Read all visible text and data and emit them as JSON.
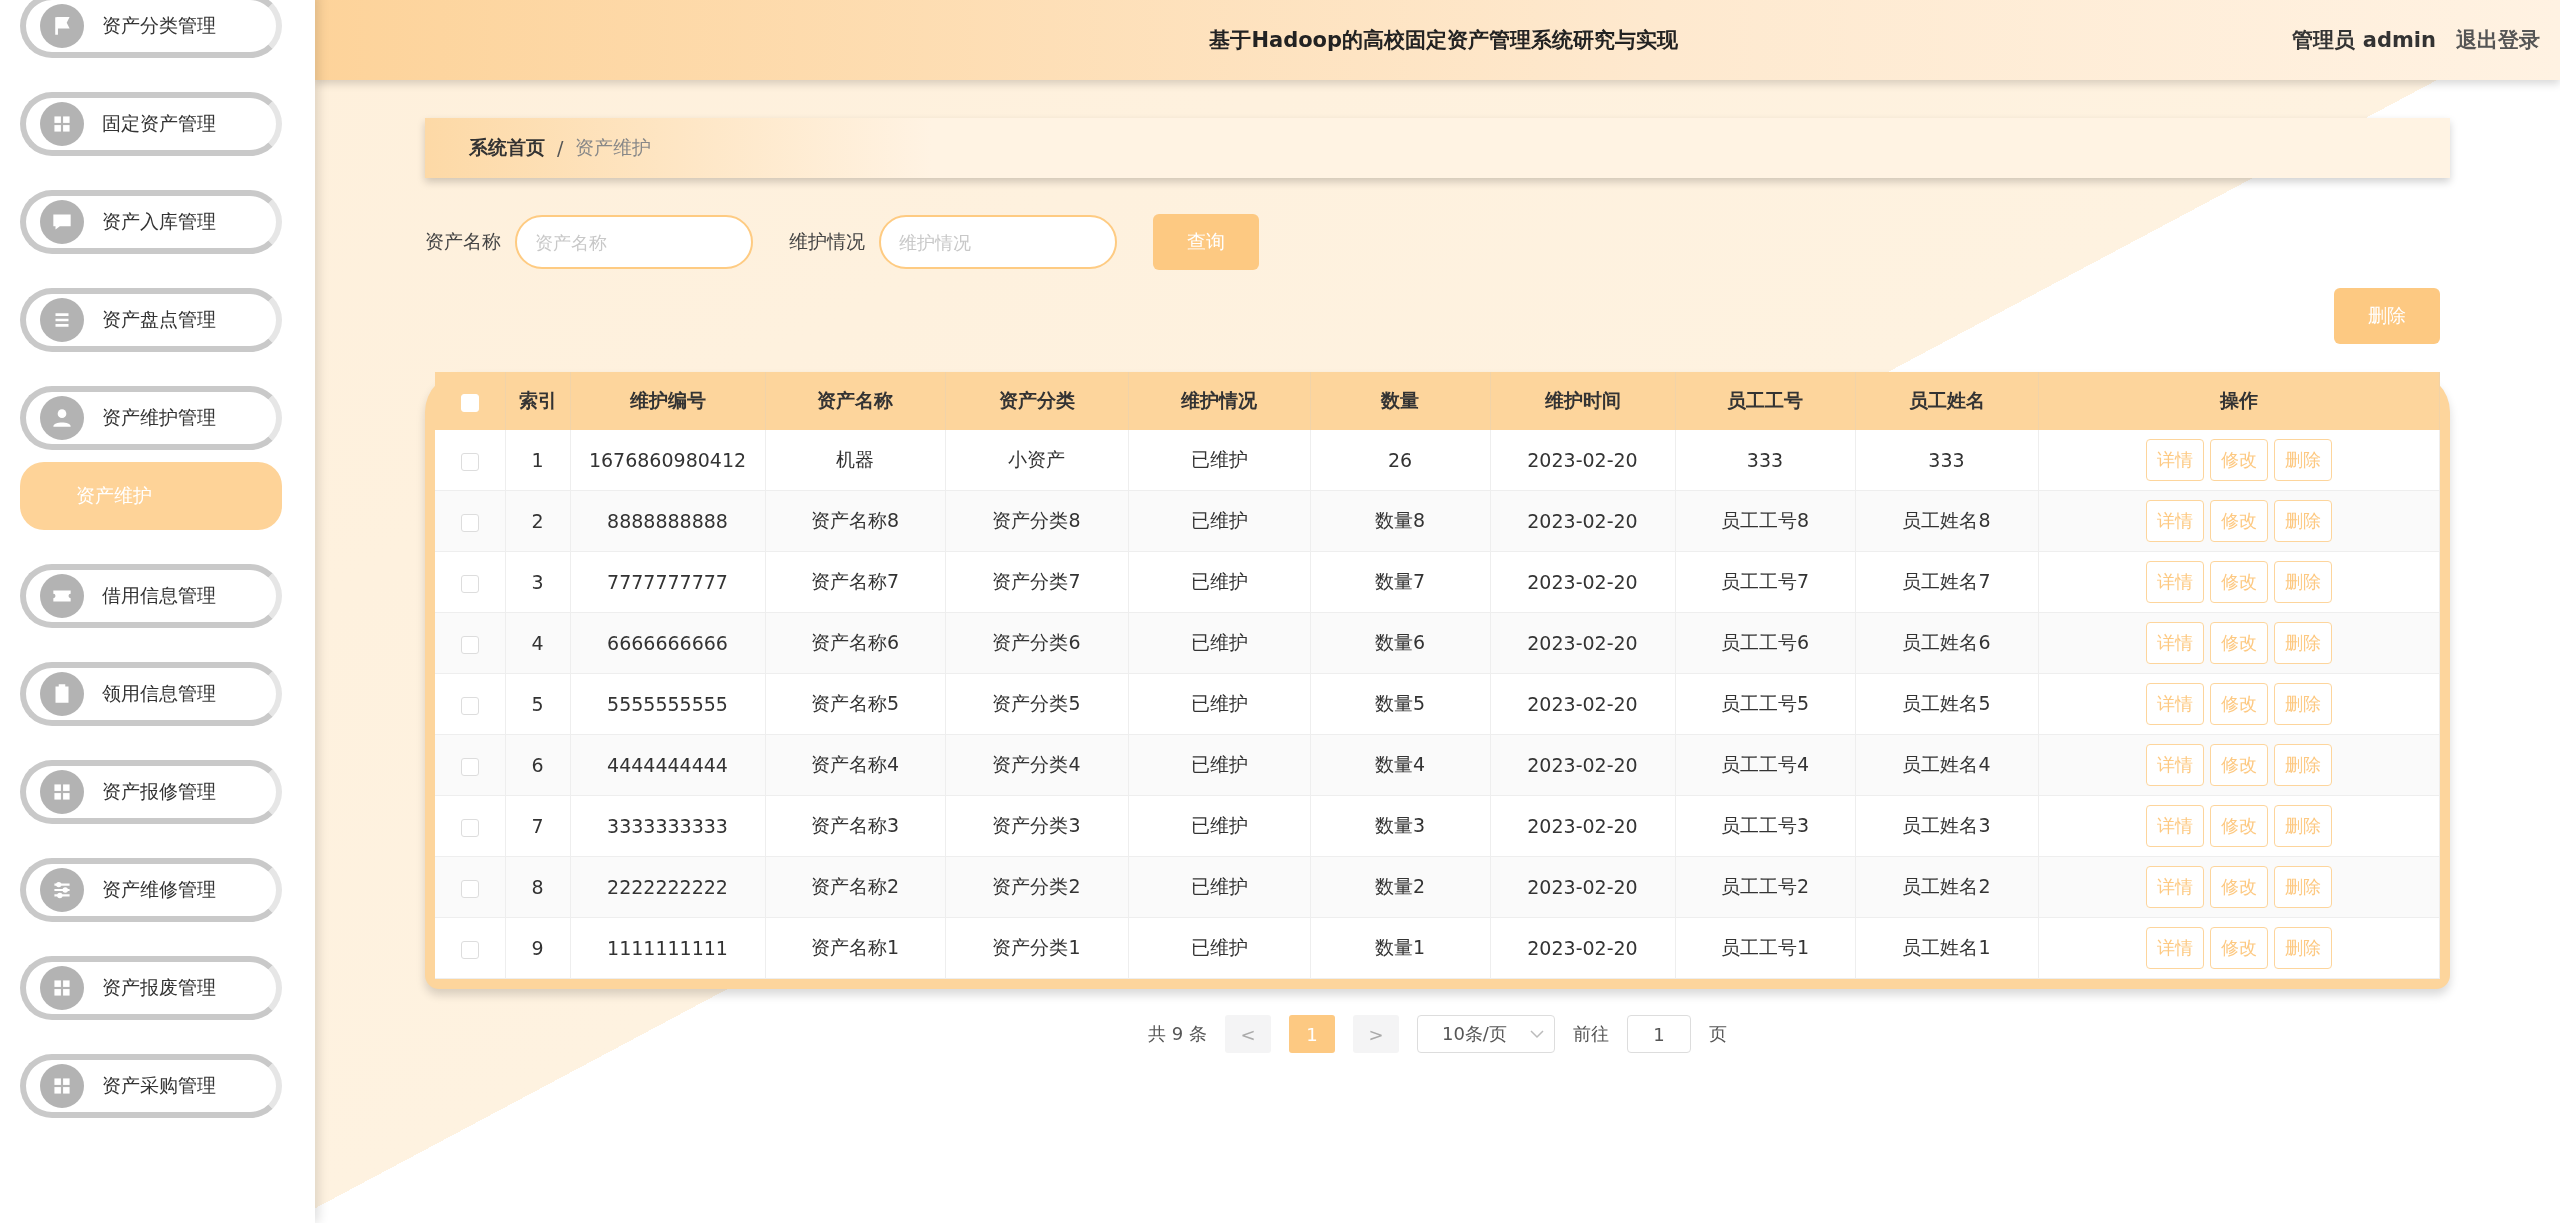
{
  "sidebar": {
    "items": [
      {
        "label": "资产分类管理"
      },
      {
        "label": "固定资产管理"
      },
      {
        "label": "资产入库管理"
      },
      {
        "label": "资产盘点管理"
      },
      {
        "label": "资产维护管理",
        "children": [
          {
            "label": "资产维护",
            "selected": true
          }
        ]
      },
      {
        "label": "借用信息管理"
      },
      {
        "label": "领用信息管理"
      },
      {
        "label": "资产报修管理"
      },
      {
        "label": "资产维修管理"
      },
      {
        "label": "资产报废管理"
      },
      {
        "label": "资产采购管理"
      }
    ]
  },
  "header": {
    "title": "基于Hadoop的高校固定资产管理系统研究与实现",
    "user": "管理员 admin",
    "logout": "退出登录"
  },
  "breadcrumb": [
    "系统首页",
    "/",
    "资产维护"
  ],
  "search": {
    "fields": [
      {
        "label": "资产名称",
        "placeholder": "资产名称"
      },
      {
        "label": "维护情况",
        "placeholder": "维护情况"
      }
    ],
    "button": "查询"
  },
  "delete_button": "删除",
  "table": {
    "header_checked": false,
    "columns": [
      "索引",
      "维护编号",
      "资产名称",
      "资产分类",
      "维护情况",
      "数量",
      "维护时间",
      "员工工号",
      "员工姓名",
      "操作"
    ],
    "rows": [
      {
        "checked": false,
        "cells": [
          "1",
          "1676860980412",
          "机器",
          "小资产",
          "已维护",
          "26",
          "2023-02-20",
          "333",
          "333"
        ],
        "actions": [
          "详情",
          "修改",
          "删除"
        ]
      },
      {
        "checked": false,
        "cells": [
          "2",
          "8888888888",
          "资产名称8",
          "资产分类8",
          "已维护",
          "数量8",
          "2023-02-20",
          "员工工号8",
          "员工姓名8"
        ],
        "actions": [
          "详情",
          "修改",
          "删除"
        ]
      },
      {
        "checked": false,
        "cells": [
          "3",
          "7777777777",
          "资产名称7",
          "资产分类7",
          "已维护",
          "数量7",
          "2023-02-20",
          "员工工号7",
          "员工姓名7"
        ],
        "actions": [
          "详情",
          "修改",
          "删除"
        ]
      },
      {
        "checked": false,
        "cells": [
          "4",
          "6666666666",
          "资产名称6",
          "资产分类6",
          "已维护",
          "数量6",
          "2023-02-20",
          "员工工号6",
          "员工姓名6"
        ],
        "actions": [
          "详情",
          "修改",
          "删除"
        ]
      },
      {
        "checked": false,
        "cells": [
          "5",
          "5555555555",
          "资产名称5",
          "资产分类5",
          "已维护",
          "数量5",
          "2023-02-20",
          "员工工号5",
          "员工姓名5"
        ],
        "actions": [
          "详情",
          "修改",
          "删除"
        ]
      },
      {
        "checked": false,
        "cells": [
          "6",
          "4444444444",
          "资产名称4",
          "资产分类4",
          "已维护",
          "数量4",
          "2023-02-20",
          "员工工号4",
          "员工姓名4"
        ],
        "actions": [
          "详情",
          "修改",
          "删除"
        ]
      },
      {
        "checked": false,
        "cells": [
          "7",
          "3333333333",
          "资产名称3",
          "资产分类3",
          "已维护",
          "数量3",
          "2023-02-20",
          "员工工号3",
          "员工姓名3"
        ],
        "actions": [
          "详情",
          "修改",
          "删除"
        ]
      },
      {
        "checked": false,
        "cells": [
          "8",
          "2222222222",
          "资产名称2",
          "资产分类2",
          "已维护",
          "数量2",
          "2023-02-20",
          "员工工号2",
          "员工姓名2"
        ],
        "actions": [
          "详情",
          "修改",
          "删除"
        ]
      },
      {
        "checked": false,
        "cells": [
          "9",
          "1111111111",
          "资产名称1",
          "资产分类1",
          "已维护",
          "数量1",
          "2023-02-20",
          "员工工号1",
          "员工姓名1"
        ],
        "actions": [
          "详情",
          "修改",
          "删除"
        ]
      }
    ]
  },
  "pagination": {
    "total": "共 9 条",
    "prev": "<",
    "pages": [
      {
        "label": "1",
        "selected": true
      }
    ],
    "next": ">",
    "page_size": "10条/页",
    "goto": "前往",
    "goto_value": "1",
    "page_unit": "页"
  }
}
